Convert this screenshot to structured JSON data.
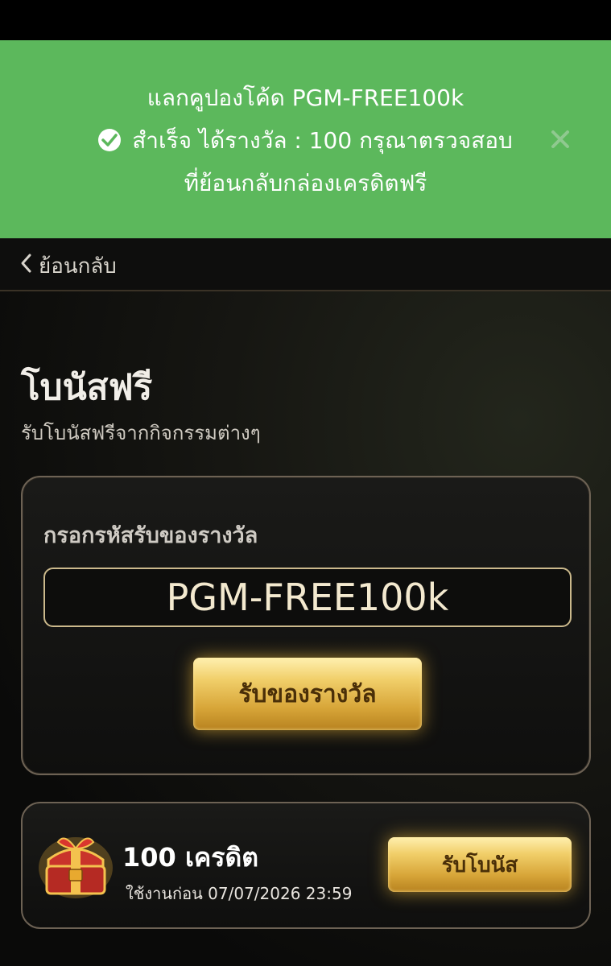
{
  "toast": {
    "line1": "แลกคูปองโค้ด PGM-FREE100k",
    "line2": "สำเร็จ ได้รางวัล : 100 กรุณาตรวจสอบ",
    "line3": "ที่ย้อนกลับกล่องเครดิตฟรี",
    "status_icon": "check-circle-icon",
    "close_icon": "close-icon",
    "background_color": "#5cb85c"
  },
  "nav": {
    "back_label": "ย้อนกลับ"
  },
  "page": {
    "title": "โบนัสฟรี",
    "subtitle": "รับโบนัสฟรีจากกิจกรรมต่างๆ"
  },
  "redeem": {
    "label": "กรอกรหัสรับของรางวัล",
    "code_value": "PGM-FREE100k",
    "button_label": "รับของรางวัล"
  },
  "bonus": {
    "icon": "treasure-chest-icon",
    "amount": "100 เครดิต",
    "expiry": "ใช้งานก่อน 07/07/2026 23:59",
    "button_label": "รับโบนัส"
  },
  "colors": {
    "accent_gold": "#d7a538",
    "card_border": "#6d6254"
  }
}
